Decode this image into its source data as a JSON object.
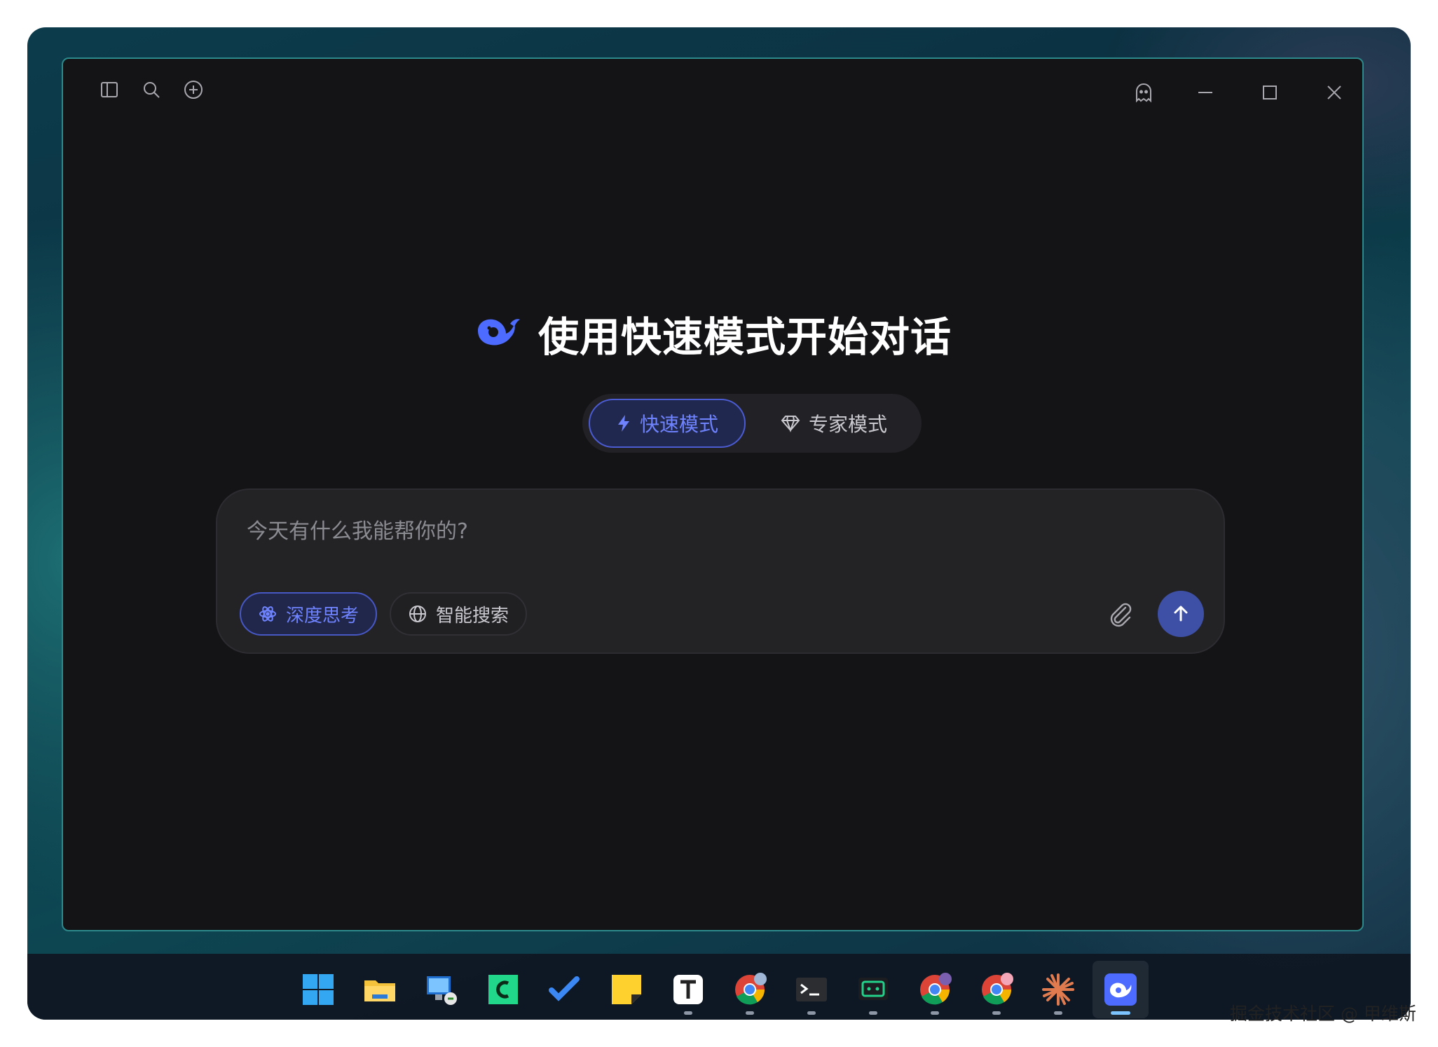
{
  "window": {
    "toolbar_icons": [
      "sidebar-toggle-icon",
      "search-icon",
      "new-chat-icon"
    ],
    "controls": [
      "ghost-icon",
      "minimize-icon",
      "maximize-icon",
      "close-icon"
    ]
  },
  "hero": {
    "logo": "deepseek-whale-logo",
    "title": "使用快速模式开始对话"
  },
  "modes": {
    "selected": "快速模式",
    "fast_label": "快速模式",
    "expert_label": "专家模式"
  },
  "composer": {
    "placeholder": "今天有什么我能帮你的?",
    "value": "",
    "deep_think_label": "深度思考",
    "smart_search_label": "智能搜索",
    "deep_think_active": true,
    "smart_search_active": false
  },
  "taskbar": {
    "apps": [
      "windows-start",
      "file-explorer",
      "remote-desktop",
      "editor-c",
      "todo",
      "sticky-notes",
      "typora",
      "chrome-1",
      "terminal",
      "ai-chat-app",
      "chrome-2",
      "chrome-3",
      "claude",
      "deepseek"
    ],
    "running": [
      "typora",
      "chrome-1",
      "terminal",
      "ai-chat-app",
      "chrome-2",
      "chrome-3",
      "claude",
      "deepseek"
    ],
    "active": "deepseek"
  },
  "watermark": "掘金技术社区 @ 甲维斯",
  "colors": {
    "accent": "#5b6ef5",
    "window_bg": "#141416",
    "border": "#2c8a8c"
  }
}
